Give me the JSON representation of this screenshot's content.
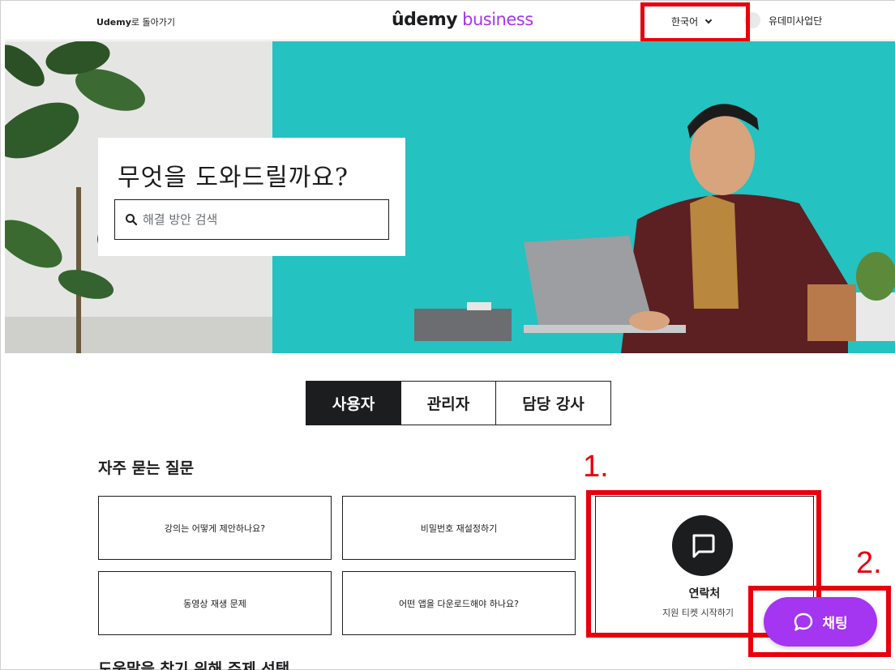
{
  "header": {
    "back_brand": "Udemy",
    "back_suffix": "로 돌아가기",
    "logo_udemy": "ûdemy",
    "logo_business": "business",
    "language": "한국어",
    "user_name": "유데미사업단"
  },
  "hero": {
    "title": "무엇을 도와드릴까요?",
    "search_placeholder": "해결 방안 검색"
  },
  "tabs": [
    {
      "label": "사용자",
      "active": true
    },
    {
      "label": "관리자",
      "active": false
    },
    {
      "label": "담당 강사",
      "active": false
    }
  ],
  "faq": {
    "title": "자주 묻는 질문",
    "items": [
      {
        "label": "강의는 어떻게 제안하나요?"
      },
      {
        "label": "비밀번호 재설정하기"
      },
      {
        "label": "동영상 재생 문제"
      },
      {
        "label": "어떤 앱을 다운로드해야 하나요?"
      }
    ]
  },
  "contact": {
    "label": "연락처",
    "subtitle": "지원 티켓 시작하기",
    "icon": "chat-bubble-icon"
  },
  "bottom_section_title": "도움말을 찾기 위해 주제 선택",
  "annotations": {
    "marker1": "1.",
    "marker2": "2."
  },
  "chat_button": {
    "label": "채팅",
    "icon": "chat-bubble-icon"
  },
  "colors": {
    "brand_purple": "#a435f0",
    "hero_teal": "#24c2c1",
    "annotation_red": "#e8000b",
    "text_dark": "#1c1d1f"
  }
}
